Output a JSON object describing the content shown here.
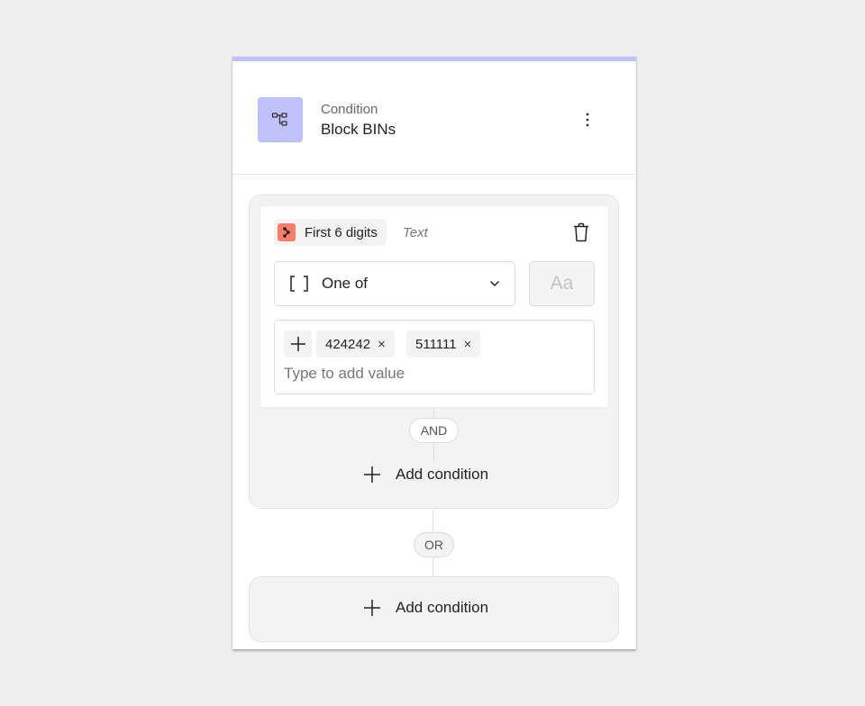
{
  "node": {
    "kind": "Condition",
    "title": "Block BINs",
    "icon": "workflow-branch-icon",
    "accent_color": "#c0c2fb",
    "more_icon": "more-vertical-icon"
  },
  "rule_groups": [
    {
      "rules": [
        {
          "field": {
            "label": "First 6 digits",
            "icon": "field-source-icon",
            "icon_color": "#f57e6b",
            "type": "Text"
          },
          "operator": {
            "icon": "brackets-icon",
            "selected": "One of"
          },
          "case_toggle_label": "Aa",
          "values": [
            "424242",
            "511111"
          ],
          "value_remove_glyph": "×",
          "value_input_placeholder": "Type to add value"
        }
      ],
      "joiner_label": "AND",
      "add_condition_label": "Add condition"
    }
  ],
  "group_joiner_label": "OR",
  "add_group_label": "Add condition"
}
